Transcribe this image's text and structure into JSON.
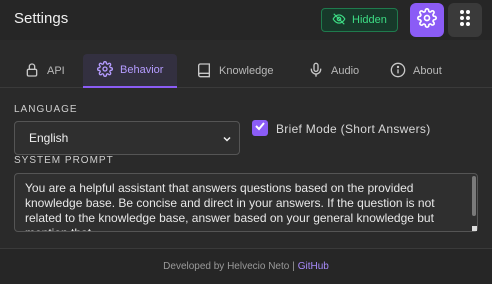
{
  "header": {
    "title": "Settings",
    "hidden_label": "Hidden",
    "icons": {
      "hidden": "eye-off-icon",
      "settings": "gear-icon",
      "menu": "drag-handle-icon"
    },
    "accent_color": "#8b5cf6",
    "hidden_color": "#3ddc84"
  },
  "tabs": [
    {
      "label": "API",
      "icon": "lock-icon",
      "active": false
    },
    {
      "label": "Behavior",
      "icon": "gear-icon",
      "active": true
    },
    {
      "label": "Knowledge",
      "icon": "book-icon",
      "active": false
    },
    {
      "label": "Audio",
      "icon": "microphone-icon",
      "active": false
    },
    {
      "label": "About",
      "icon": "info-icon",
      "active": false
    }
  ],
  "behavior": {
    "language_label": "LANGUAGE",
    "language_value": "English",
    "brief_mode_label": "Brief Mode (Short Answers)",
    "brief_mode_checked": true,
    "system_prompt_label": "SYSTEM PROMPT",
    "system_prompt_value": "You are a helpful assistant that answers questions based on the provided knowledge base. Be concise and direct in your answers. If the question is not related to the knowledge base, answer based on your general knowledge but mention that."
  },
  "footer": {
    "text": "Developed by Helvecio Neto |",
    "link_label": "GitHub"
  }
}
